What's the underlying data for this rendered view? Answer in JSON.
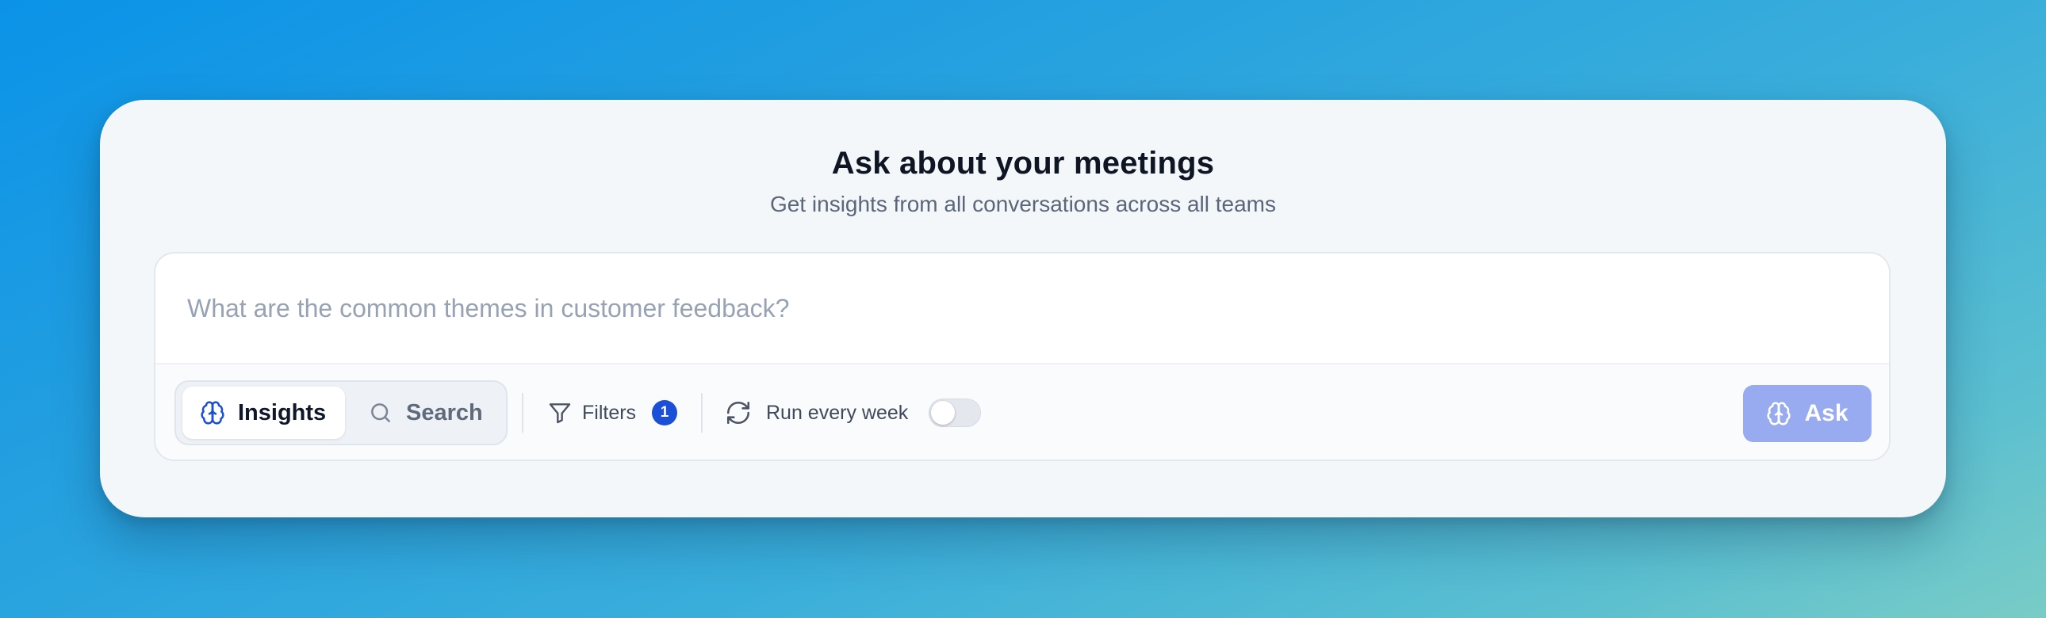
{
  "header": {
    "title": "Ask about your meetings",
    "subtitle": "Get insights from all conversations across all teams"
  },
  "query": {
    "placeholder": "What are the common themes in customer feedback?",
    "value": ""
  },
  "modes": [
    {
      "label": "Insights",
      "icon": "brain-icon",
      "active": true
    },
    {
      "label": "Search",
      "icon": "search-icon",
      "active": false
    }
  ],
  "filters": {
    "label": "Filters",
    "icon": "filter-icon",
    "count": "1"
  },
  "schedule": {
    "label": "Run every week",
    "icon": "refresh-icon",
    "enabled": false
  },
  "ask_button": {
    "label": "Ask",
    "icon": "brain-icon",
    "disabled": true
  },
  "colors": {
    "accent": "#1c4fd8",
    "ask_button_disabled": "#98aaf0",
    "background_gradient_start": "#0b93e8",
    "background_gradient_end": "#79ccc6",
    "card": "#f3f7fa"
  }
}
